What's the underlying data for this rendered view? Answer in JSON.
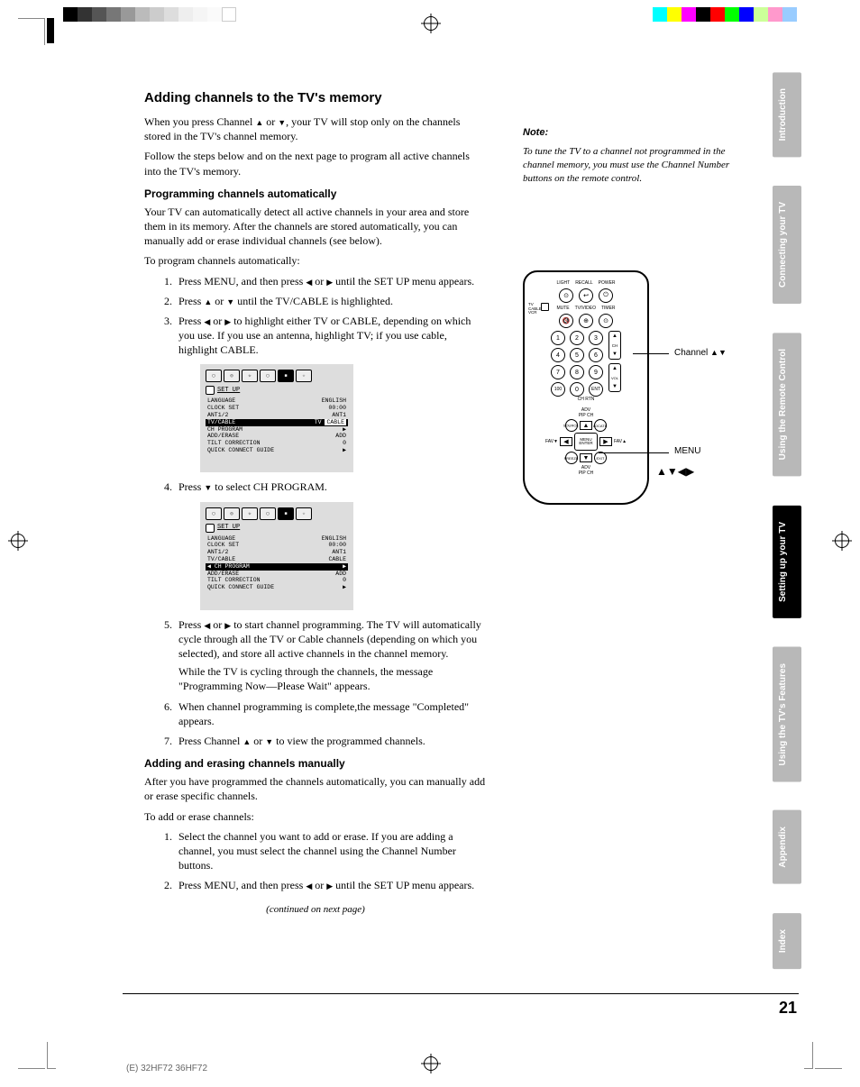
{
  "title": "Adding channels to the TV's memory",
  "intro1a": "When you press Channel ",
  "intro1b": " or ",
  "intro1c": ", your TV will stop only on the channels stored in the TV's channel memory.",
  "intro2": "Follow the steps below and on the next page to program all active channels into the TV's memory.",
  "h3_prog": "Programming channels automatically",
  "prog_p1": "Your TV can automatically detect all active channels in your area and store them in its memory. After the channels are stored automatically, you can manually add or erase individual channels (see below).",
  "prog_p2": "To program channels automatically:",
  "step1a": "Press MENU, and then press ",
  "step1b": " or ",
  "step1c": " until the SET UP menu appears.",
  "step2a": "Press ",
  "step2b": " or ",
  "step2c": " until the TV/CABLE is highlighted.",
  "step3a": "Press ",
  "step3b": " or ",
  "step3c": " to highlight either TV or CABLE, depending on which you use. If you use an antenna, highlight TV; if you use cable, highlight CABLE.",
  "step4a": "Press ",
  "step4b": " to select CH PROGRAM.",
  "step5a": "Press ",
  "step5b": " or ",
  "step5c": " to start channel programming. The TV will automatically cycle through all the TV or Cable channels (depending on which you selected), and store all active channels in the channel memory.",
  "step5d": "While the TV is cycling through the channels, the message \"Programming Now—Please Wait\" appears.",
  "step6": "When channel programming is complete,the message \"Completed\" appears.",
  "step7a": "Press Channel ",
  "step7b": " or ",
  "step7c": " to view the programmed channels.",
  "h3_add": "Adding and erasing channels manually",
  "add_p1": "After you have programmed the channels automatically, you can manually add or erase specific channels.",
  "add_p2": "To add or erase channels:",
  "addstep1": "Select the channel you want to add or erase. If you are adding a channel, you must select the channel using the Channel Number buttons.",
  "addstep2a": "Press MENU, and then press ",
  "addstep2b": " or ",
  "addstep2c": " until the SET UP menu appears.",
  "continued": "(continued on next page)",
  "note_title": "Note:",
  "note_body": "To tune the TV to a channel not programmed in the channel memory, you must use the Channel Number buttons on the remote control.",
  "callout_channel": "Channel ",
  "callout_menu": "MENU",
  "callout_arrows": "▲▼◀▶",
  "menu_setup": "SET UP",
  "menu_rows1": [
    {
      "l": "LANGUAGE",
      "v": "ENGLISH"
    },
    {
      "l": "CLOCK SET",
      "v": "00:00"
    },
    {
      "l": "ANT1/2",
      "v": "ANT1"
    }
  ],
  "menu_hl1": {
    "l": "TV/CABLE",
    "v": "TV",
    "v2": "CABLE"
  },
  "menu_rows1b": [
    {
      "l": "CH PROGRAM",
      "v": "▶"
    },
    {
      "l": "ADD/ERASE",
      "v": "ADD"
    },
    {
      "l": "TILT CORRECTION",
      "v": "0"
    },
    {
      "l": "QUICK CONNECT GUIDE",
      "v": "▶"
    }
  ],
  "menu_rows2": [
    {
      "l": "LANGUAGE",
      "v": "ENGLISH"
    },
    {
      "l": "CLOCK SET",
      "v": "00:00"
    },
    {
      "l": "ANT1/2",
      "v": "ANT1"
    },
    {
      "l": "TV/CABLE",
      "v": "CABLE"
    }
  ],
  "menu_hl2": {
    "l": "CH PROGRAM",
    "v": "▶"
  },
  "menu_rows2b": [
    {
      "l": "ADD/ERASE",
      "v": "ADD"
    },
    {
      "l": "TILT CORRECTION",
      "v": "0"
    },
    {
      "l": "QUICK CONNECT GUIDE",
      "v": "▶"
    }
  ],
  "remote_labels": {
    "top": [
      "LIGHT",
      "RECALL",
      "POWER"
    ],
    "switch": [
      "TV",
      "CABLE",
      "VCR"
    ],
    "row2": [
      "MUTE",
      "TV/VIDEO",
      "TIMER"
    ],
    "ch": "CH",
    "vol": "VOL",
    "chrtn": "CH RTN",
    "ent": "ENT",
    "hundred": "100",
    "adv": "ADV",
    "pipch": "PIP CH",
    "menu": "MENU",
    "enter": "ENTER",
    "fav_down": "FAV▼",
    "fav_up": "FAV▲",
    "source": "SOURCE",
    "locate": "LOCATE",
    "freeze": "FREEZE",
    "exit": "EXIT"
  },
  "tabs": [
    "Introduction",
    "Connecting your TV",
    "Using the Remote Control",
    "Setting up your TV",
    "Using the TV's Features",
    "Appendix",
    "Index"
  ],
  "active_tab": 3,
  "page_number": "21",
  "footer": "(E) 32HF72 36HF72",
  "tri_up": "▲",
  "tri_down": "▼",
  "tri_left": "◀",
  "tri_right": "▶"
}
